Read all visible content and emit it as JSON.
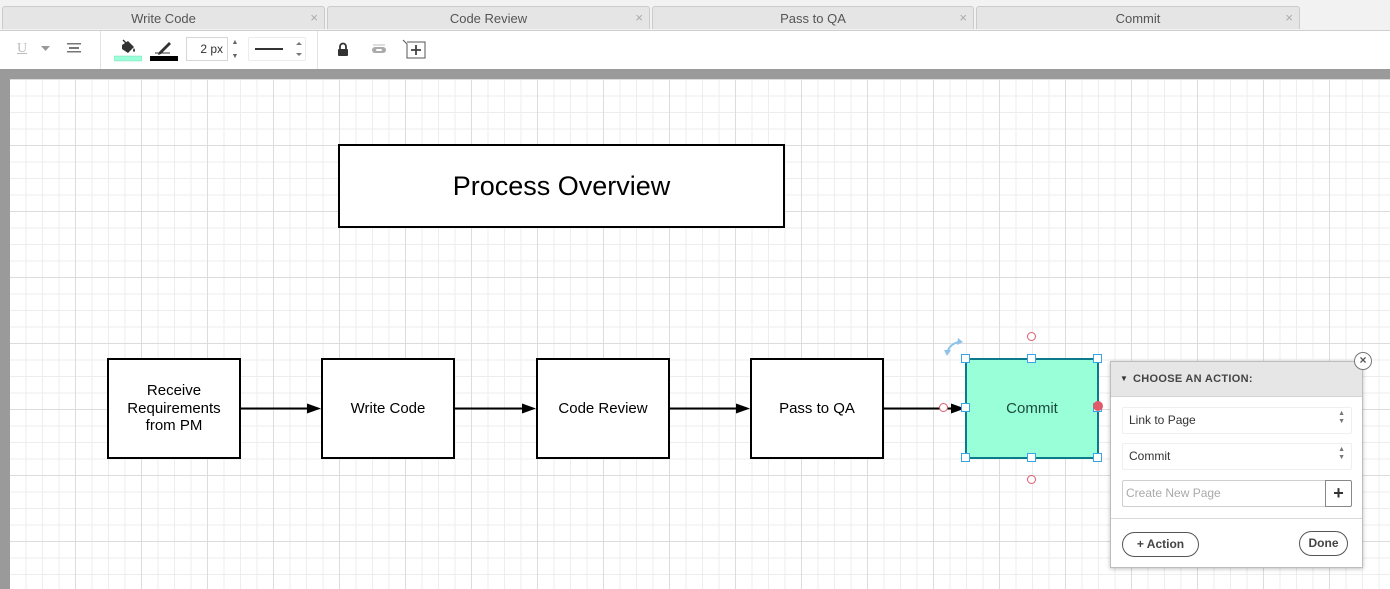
{
  "tabs": [
    {
      "label": "Write Code",
      "close": "×"
    },
    {
      "label": "Code Review",
      "close": "×"
    },
    {
      "label": "Pass to QA",
      "close": "×"
    },
    {
      "label": "Commit",
      "close": "×"
    }
  ],
  "toolbar": {
    "underline_icon": "U",
    "stroke_width": "2 px",
    "fill_color": "#99ffd8",
    "line_color": "#000000"
  },
  "diagram": {
    "title": "Process Overview",
    "nodes": [
      {
        "id": "receive",
        "label": "Receive\nRequirements\nfrom PM"
      },
      {
        "id": "write",
        "label": "Write Code"
      },
      {
        "id": "review",
        "label": "Code Review"
      },
      {
        "id": "qa",
        "label": "Pass to QA"
      },
      {
        "id": "commit",
        "label": "Commit",
        "selected": true,
        "fill": "#99ffd8"
      }
    ],
    "edges": [
      {
        "from": "receive",
        "to": "write"
      },
      {
        "from": "write",
        "to": "review"
      },
      {
        "from": "review",
        "to": "qa"
      },
      {
        "from": "qa",
        "to": "commit"
      }
    ]
  },
  "action_panel": {
    "title": "CHOOSE AN ACTION:",
    "action_type": "Link to Page",
    "target_page": "Commit",
    "new_page_placeholder": "Create New Page",
    "add_page_label": "+",
    "add_action_label": "+ Action",
    "done_label": "Done",
    "close": "×"
  }
}
